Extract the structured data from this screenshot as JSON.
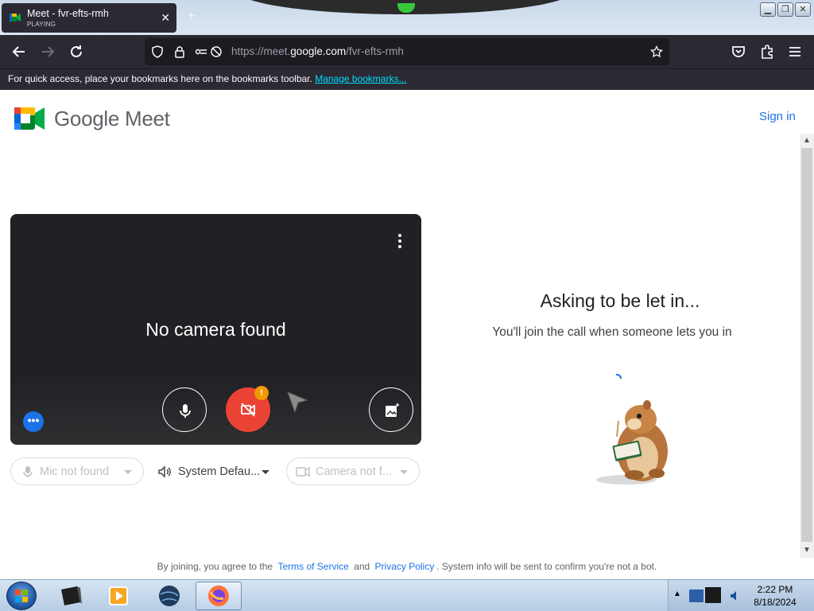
{
  "browser": {
    "tab": {
      "title": "Meet - fvr-efts-rmh",
      "status": "PLAYING",
      "new_tab": "+"
    },
    "window_controls": {
      "minimize": "▁",
      "restore": "❐",
      "close": "✕"
    },
    "url": {
      "prefix": "https://meet.",
      "domain": "google.com",
      "path": "/fvr-efts-rmh"
    },
    "bookmarks_bar": {
      "message": "For quick access, place your bookmarks here on the bookmarks toolbar.",
      "link": "Manage bookmarks..."
    }
  },
  "page": {
    "brand": "Google Meet",
    "sign_in": "Sign in",
    "preview": {
      "message": "No camera found",
      "camera_badge": "!",
      "more_options": "•••"
    },
    "devices": {
      "mic": "Mic not found",
      "speaker": "System Defau...",
      "camera": "Camera not f..."
    },
    "status": {
      "title": "Asking to be let in...",
      "subtitle": "You'll join the call when someone lets you in"
    },
    "footer": {
      "prefix": "By joining, you agree to the",
      "terms": "Terms of Service",
      "and": "and",
      "privacy": "Privacy Policy",
      "suffix": ". System info will be sent to confirm you're not a bot."
    }
  },
  "taskbar": {
    "time": "2:22 PM",
    "date": "8/18/2024"
  },
  "colors": {
    "accent_blue": "#1a73e8",
    "camera_off_red": "#ea4335",
    "warning_orange": "#f29900",
    "browser_chrome": "#2b2a33"
  }
}
